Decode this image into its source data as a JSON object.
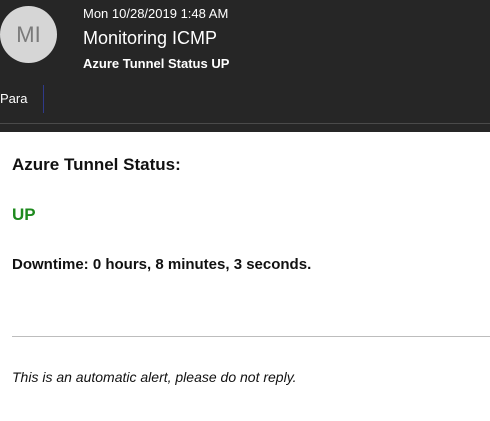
{
  "header": {
    "avatar_initials": "MI",
    "date": "Mon 10/28/2019 1:48 AM",
    "sender": "Monitoring ICMP",
    "subject": "Azure Tunnel Status UP",
    "attachment_label": "Para"
  },
  "body": {
    "title": "Azure Tunnel Status:",
    "status": "UP",
    "status_color": "#1e8a1e",
    "downtime": "Downtime: 0 hours, 8 minutes, 3 seconds.",
    "footer": "This is an automatic alert, please do not reply."
  }
}
